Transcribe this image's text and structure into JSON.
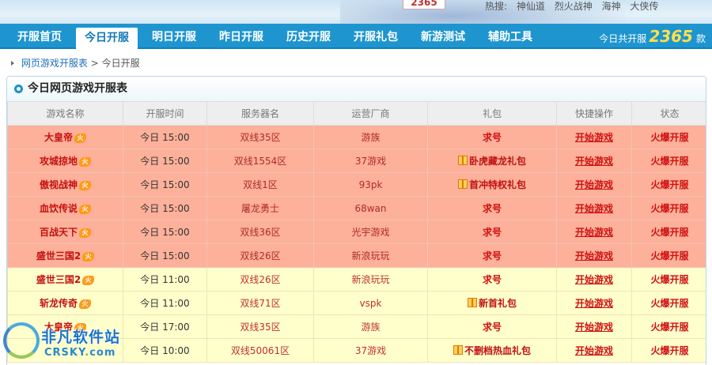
{
  "banner": {
    "counter": "2365",
    "hot_search_label": "热搜:",
    "hot_search_items": [
      "神仙道",
      "烈火战神",
      "海神",
      "大侠传"
    ]
  },
  "nav": {
    "tabs": [
      "开服首页",
      "今日开服",
      "明日开服",
      "昨日开服",
      "历史开服",
      "开服礼包",
      "新游测试",
      "辅助工具"
    ],
    "active_tab": "今日开服",
    "count_prefix": "今日共开服",
    "count_value": "2365",
    "count_suffix": "款"
  },
  "breadcrumb": {
    "root": "网页游戏开服表",
    "separator": ">",
    "current": "今日开服"
  },
  "panel": {
    "title": "今日网页游戏开服表",
    "columns": [
      "游戏名称",
      "开服时间",
      "服务器名",
      "运营厂商",
      "礼包",
      "快捷操作",
      "状态"
    ],
    "fire_badge": "火",
    "rows": [
      {
        "name": "大皇帝",
        "time": "今日 15:00",
        "server": "双线35区",
        "vendor": "游族",
        "gift": "求号",
        "gift_type": "request",
        "action": "开始游戏",
        "status": "火爆开服",
        "tone": "hot"
      },
      {
        "name": "攻城掠地",
        "time": "今日 15:00",
        "server": "双线1554区",
        "vendor": "37游戏",
        "gift": "卧虎藏龙礼包",
        "gift_type": "pack",
        "action": "开始游戏",
        "status": "火爆开服",
        "tone": "hot"
      },
      {
        "name": "傲视战神",
        "time": "今日 15:00",
        "server": "双线1区",
        "vendor": "93pk",
        "gift": "首冲特权礼包",
        "gift_type": "pack",
        "action": "开始游戏",
        "status": "火爆开服",
        "tone": "hot"
      },
      {
        "name": "血饮传说",
        "time": "今日 15:00",
        "server": "屠龙勇士",
        "vendor": "68wan",
        "gift": "求号",
        "gift_type": "request",
        "action": "开始游戏",
        "status": "火爆开服",
        "tone": "hot"
      },
      {
        "name": "百战天下",
        "time": "今日 15:00",
        "server": "双线36区",
        "vendor": "光宇游戏",
        "gift": "求号",
        "gift_type": "request",
        "action": "开始游戏",
        "status": "火爆开服",
        "tone": "hot"
      },
      {
        "name": "盛世三国2",
        "time": "今日 15:00",
        "server": "双线26区",
        "vendor": "新浪玩玩",
        "gift": "求号",
        "gift_type": "request",
        "action": "开始游戏",
        "status": "火爆开服",
        "tone": "hot"
      },
      {
        "name": "盛世三国2",
        "time": "今日 11:00",
        "server": "双线26区",
        "vendor": "新浪玩玩",
        "gift": "求号",
        "gift_type": "request",
        "action": "开始游戏",
        "status": "火爆开服",
        "tone": "warm"
      },
      {
        "name": "斩龙传奇",
        "time": "今日 11:00",
        "server": "双线71区",
        "vendor": "vspk",
        "gift": "新首礼包",
        "gift_type": "pack",
        "action": "开始游戏",
        "status": "火爆开服",
        "tone": "warm"
      },
      {
        "name": "大皇帝",
        "time": "今日 17:00",
        "server": "双线35区",
        "vendor": "游族",
        "gift": "求号",
        "gift_type": "request",
        "action": "开始游戏",
        "status": "火爆开服",
        "tone": "warm"
      },
      {
        "name": "",
        "time": "今日 10:00",
        "server": "双线50061区",
        "vendor": "37游戏",
        "gift": "不删档热血礼包",
        "gift_type": "pack",
        "action": "开始游戏",
        "status": "火爆开服",
        "tone": "warm"
      }
    ]
  },
  "watermark": {
    "title": "非凡软件站",
    "subtitle_left": "CRSKY",
    "subtitle_dot": ".",
    "subtitle_right": "com"
  },
  "colors": {
    "nav_blue": "#1e95cf",
    "hot_row": "#fdb09a",
    "warm_row": "#ffffcc",
    "link_red": "#d01010",
    "count_yellow": "#ffe04a"
  }
}
